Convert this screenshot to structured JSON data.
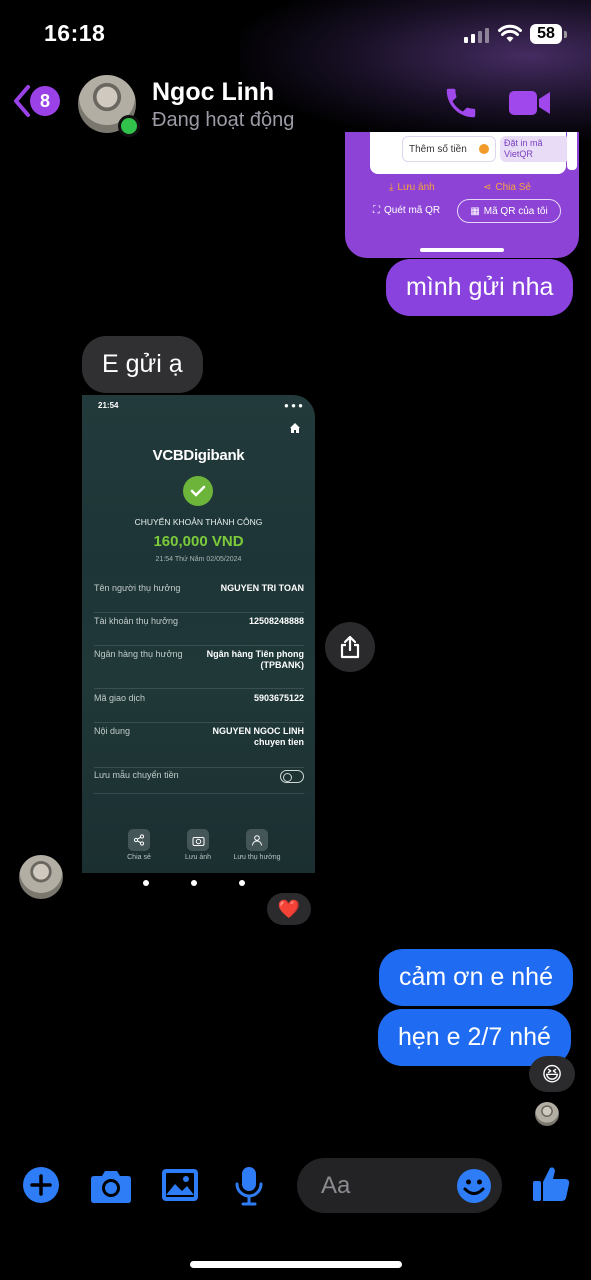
{
  "status_bar": {
    "time": "16:18",
    "battery": "58"
  },
  "header": {
    "back_badge": "8",
    "contact_name": "Ngoc Linh",
    "contact_status": "Đang hoạt động"
  },
  "shared_card": {
    "add_amount": "Thêm số tiền",
    "print_vietqr": "Đặt in mã VietQR",
    "save_image": "Lưu ảnh",
    "share": "Chia Sẻ",
    "scan_qr": "Quét mã QR",
    "my_qr": "Mã QR của tôi"
  },
  "messages": {
    "sent_1": "mình gửi nha",
    "received_1": "E gửi ạ",
    "sent_2": "cảm ơn e nhé",
    "sent_3": "hẹn e 2/7 nhé"
  },
  "reactions": {
    "received_image": "❤️",
    "sent_3": "😆"
  },
  "receipt": {
    "status_time": "21:54",
    "logo_vcb": "VCB",
    "logo_rest": "Digibank",
    "title": "CHUYỂN KHOẢN THÀNH CÔNG",
    "amount": "160,000 VND",
    "datetime": "21:54 Thứ Năm 02/05/2024",
    "rows": [
      {
        "label": "Tên người thụ hưởng",
        "value": "NGUYEN TRI TOAN"
      },
      {
        "label": "Tài khoản thụ hưởng",
        "value": "12508248888"
      },
      {
        "label": "Ngân hàng thụ hưởng",
        "value": "Ngân hàng Tiên phong\n(TPBANK)"
      },
      {
        "label": "Mã giao dịch",
        "value": "5903675122"
      },
      {
        "label": "Nội dung",
        "value": "NGUYEN NGOC LINH\nchuyen tien"
      }
    ],
    "save_template": "Lưu mẫu chuyển tiền",
    "actions": [
      "Chia sẻ",
      "Lưu ảnh",
      "Lưu thụ hưởng"
    ]
  },
  "composer": {
    "placeholder": "Aa"
  },
  "colors": {
    "sent_blue": "#1f6cf2",
    "sent_purple": "#8a42de",
    "received_gray": "#303033",
    "accent": "#9a42e8"
  }
}
